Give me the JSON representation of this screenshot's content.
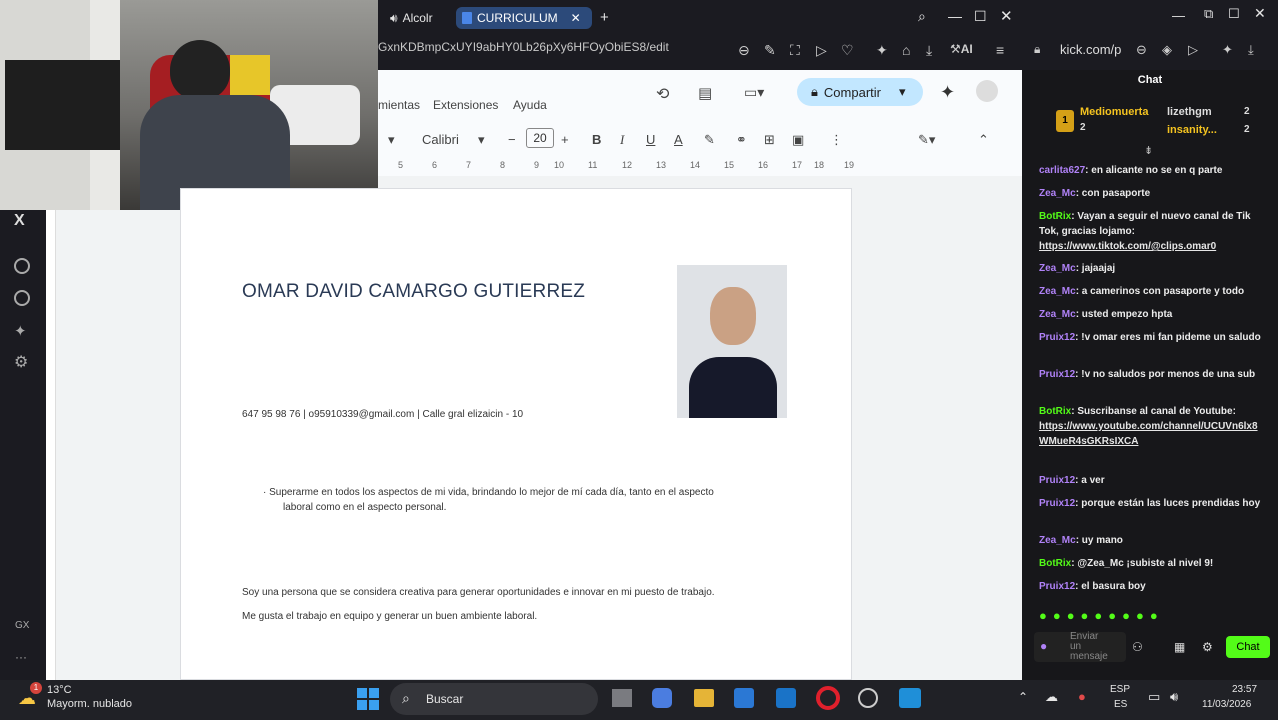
{
  "browser": {
    "tabs": [
      {
        "label": "Alcolr"
      },
      {
        "label": "CURRICULUM"
      }
    ],
    "url": "GxnKDBmpCxUYI9abHY0Lb26pXy6HFOyObiES8/edit",
    "right_url": "kick.com/p"
  },
  "gdocs": {
    "menus": [
      "mientas",
      "Extensiones",
      "Ayuda"
    ],
    "share_label": "Compartir",
    "font": "Calibri",
    "font_size": "20",
    "ruler_ticks": [
      "5",
      "6",
      "7",
      "8",
      "9",
      "10",
      "11",
      "12",
      "13",
      "14",
      "15",
      "16",
      "17",
      "18",
      "19"
    ]
  },
  "document": {
    "name": "OMAR DAVID CAMARGO GUTIERREZ",
    "contact": "647 95 98 76 | o95910339@gmail.com | Calle gral elizaicin - 10",
    "objective_line1": "· Superarme en todos los aspectos de mi vida, brindando lo mejor de mí cada día, tanto en el aspecto",
    "objective_line2": "laboral como en el aspecto personal.",
    "profile_line1": "Soy una persona que se considera creativa para generar oportunidades e innovar en mi puesto de trabajo.",
    "profile_line2": "Me gusta el trabajo en equipo y generar un buen ambiente laboral."
  },
  "chat": {
    "title": "Chat",
    "leaders": [
      {
        "name": "Mediomuerta",
        "count": "2"
      },
      {
        "name": "lizethgm",
        "count": "2"
      },
      {
        "name": "insanity...",
        "count": "2"
      }
    ],
    "leader_rank": "1",
    "messages": [
      {
        "user": "carlita627",
        "text": "en alicante no se en q parte"
      },
      {
        "user": "Zea_Mc",
        "text": "con pasaporte"
      },
      {
        "user": "BotRix",
        "text": "Vayan a seguir el nuevo canal de Tik Tok, gracias lojamo:",
        "link": "https://www.tiktok.com/@clips.omar0"
      },
      {
        "user": "Zea_Mc",
        "text": "jajaajaj"
      },
      {
        "user": "Zea_Mc",
        "text": "a camerinos con pasaporte y todo"
      },
      {
        "user": "Zea_Mc",
        "text": "usted empezo hpta"
      },
      {
        "user": "Pruix12",
        "text": "!v omar eres mi fan pideme un saludo"
      },
      {
        "user": "Pruix12",
        "text": "!v no saludos por menos de una sub"
      },
      {
        "user": "BotRix",
        "text": "Suscribanse al canal de Youtube:",
        "link": "https://www.youtube.com/channel/UCUVn6lx8WMueR4sGKRsIXCA"
      },
      {
        "user": "Pruix12",
        "text": "a ver"
      },
      {
        "user": "Pruix12",
        "text": "porque están las luces prendidas hoy"
      },
      {
        "user": "Zea_Mc",
        "text": "uy mano"
      },
      {
        "user": "BotRix",
        "text": "@Zea_Mc ¡subiste al nivel 9!"
      },
      {
        "user": "Pruix12",
        "text": "el basura boy"
      }
    ],
    "input_placeholder": "Enviar un mensaje",
    "send_label": "Chat"
  },
  "taskbar": {
    "temp": "13°C",
    "weather": "Mayorm. nublado",
    "weather_badge": "1",
    "search": "Buscar",
    "lang1": "ESP",
    "lang2": "ES",
    "time": "23:57",
    "date": "11/03/2026"
  },
  "sidebar": {
    "gx_label": "GX"
  }
}
